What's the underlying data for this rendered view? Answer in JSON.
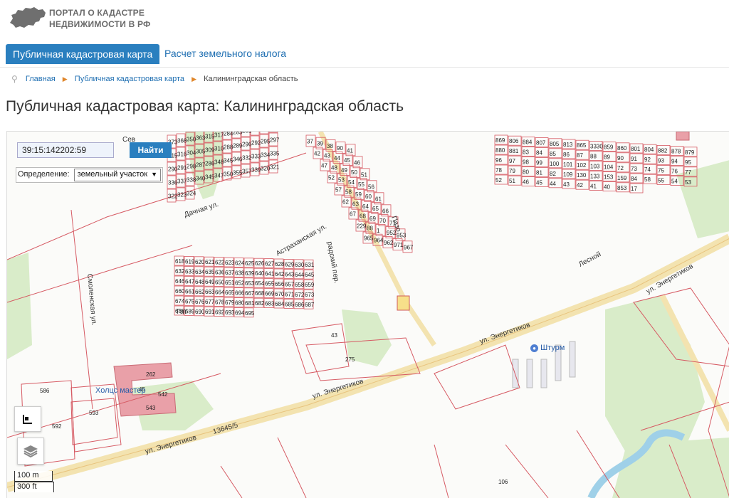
{
  "header": {
    "logo_icon": "russia-map-icon",
    "logo_line1": "ПОРТАЛ О КАДАСТРЕ",
    "logo_line2": "НЕДВИЖИМОСТИ В РФ"
  },
  "nav": {
    "active_tab": "Публичная кадастровая карта",
    "tab2": "Расчет земельного налога"
  },
  "breadcrumb": {
    "home": "Главная",
    "section": "Публичная кадастровая карта",
    "current": "Калининградская область"
  },
  "page": {
    "title": "Публичная кадастровая карта: Калининградская область"
  },
  "map": {
    "search_value": "39:15:142202:59",
    "search_button": "Найти",
    "definition_label": "Определение:",
    "definition_value": "земельный участок",
    "scale_m": "100 m",
    "scale_ft": "300 ft",
    "poi_shturm": "Штурм",
    "poi_kholts": "Холцс мастер",
    "streets": {
      "energetikov_1": "ул. Энергетиков",
      "energetikov_2": "ул. Энергетиков",
      "energetikov_3": "ул. Энергетиков",
      "energetikov_4": "ул. Энергетиков",
      "energetikov_code": "13645/5",
      "smolenskaya": "Смоленская ул.",
      "astrakhanskaya": "Астраханская ул.",
      "dachnaya": "Дачная ул.",
      "gat": "Гат",
      "pazo": "Пазо",
      "sev": "Сев",
      "lesnoy": "Лесной",
      "grad": "радский пер."
    },
    "parcels": {
      "p_left": [
        "373",
        "368",
        "350",
        "363",
        "315",
        "317",
        "284",
        "283",
        "281",
        "279",
        "276",
        "278",
        "315",
        "316",
        "304",
        "305",
        "309",
        "310",
        "288",
        "289",
        "296",
        "292",
        "295",
        "297",
        "290",
        "291",
        "298",
        "287",
        "286",
        "348",
        "345",
        "346",
        "332",
        "333",
        "334",
        "335",
        "336",
        "337",
        "338",
        "340",
        "345",
        "347",
        "350",
        "355",
        "357",
        "339",
        "320",
        "321",
        "322",
        "323",
        "324"
      ],
      "p_mid": [
        "37",
        "39",
        "38",
        "90",
        "41",
        "42",
        "43",
        "44",
        "45",
        "46",
        "47",
        "48",
        "49",
        "50",
        "51",
        "52",
        "53",
        "54",
        "55",
        "56",
        "57",
        "58",
        "59",
        "60",
        "61",
        "62",
        "63",
        "64",
        "65",
        "66",
        "67",
        "68",
        "69",
        "70",
        "71",
        "229",
        "88",
        "1",
        "952",
        "953",
        "965",
        "964",
        "962",
        "971",
        "967"
      ],
      "p_grid": [
        "618",
        "619",
        "620",
        "621",
        "622",
        "623",
        "624",
        "625",
        "626",
        "627",
        "628",
        "629",
        "630",
        "631",
        "632",
        "633",
        "634",
        "635",
        "636",
        "637",
        "638",
        "639",
        "640",
        "641",
        "642",
        "643",
        "644",
        "645",
        "646",
        "647",
        "648",
        "649",
        "650",
        "651",
        "652",
        "653",
        "654",
        "655",
        "656",
        "657",
        "658",
        "659",
        "660",
        "661",
        "662",
        "663",
        "664",
        "665",
        "666",
        "667",
        "668",
        "669",
        "670",
        "671",
        "672",
        "673",
        "674",
        "675",
        "676",
        "677",
        "678",
        "679",
        "680",
        "681",
        "682",
        "683",
        "684",
        "685",
        "686",
        "687",
        "688",
        "689",
        "690",
        "691",
        "692",
        "693",
        "694",
        "695"
      ],
      "p_right": [
        "869",
        "806",
        "884",
        "807",
        "805",
        "813",
        "865",
        "3330",
        "859",
        "860",
        "801",
        "804",
        "882",
        "878",
        "879",
        "880",
        "881",
        "83",
        "84",
        "85",
        "86",
        "87",
        "88",
        "89",
        "90",
        "91",
        "92",
        "93",
        "94",
        "95",
        "96",
        "97",
        "98",
        "99",
        "100",
        "101",
        "102",
        "103",
        "104",
        "72",
        "73",
        "74",
        "75",
        "76",
        "77",
        "78",
        "79",
        "80",
        "81",
        "82",
        "109",
        "130",
        "133",
        "153",
        "159",
        "84",
        "58",
        "55",
        "54",
        "53",
        "52",
        "51",
        "46",
        "45",
        "44",
        "43",
        "42",
        "41",
        "40",
        "853",
        "17"
      ],
      "p_misc": [
        "43",
        "275",
        "586",
        "593",
        "592",
        "262",
        "45",
        "542",
        "543",
        "106"
      ]
    }
  }
}
